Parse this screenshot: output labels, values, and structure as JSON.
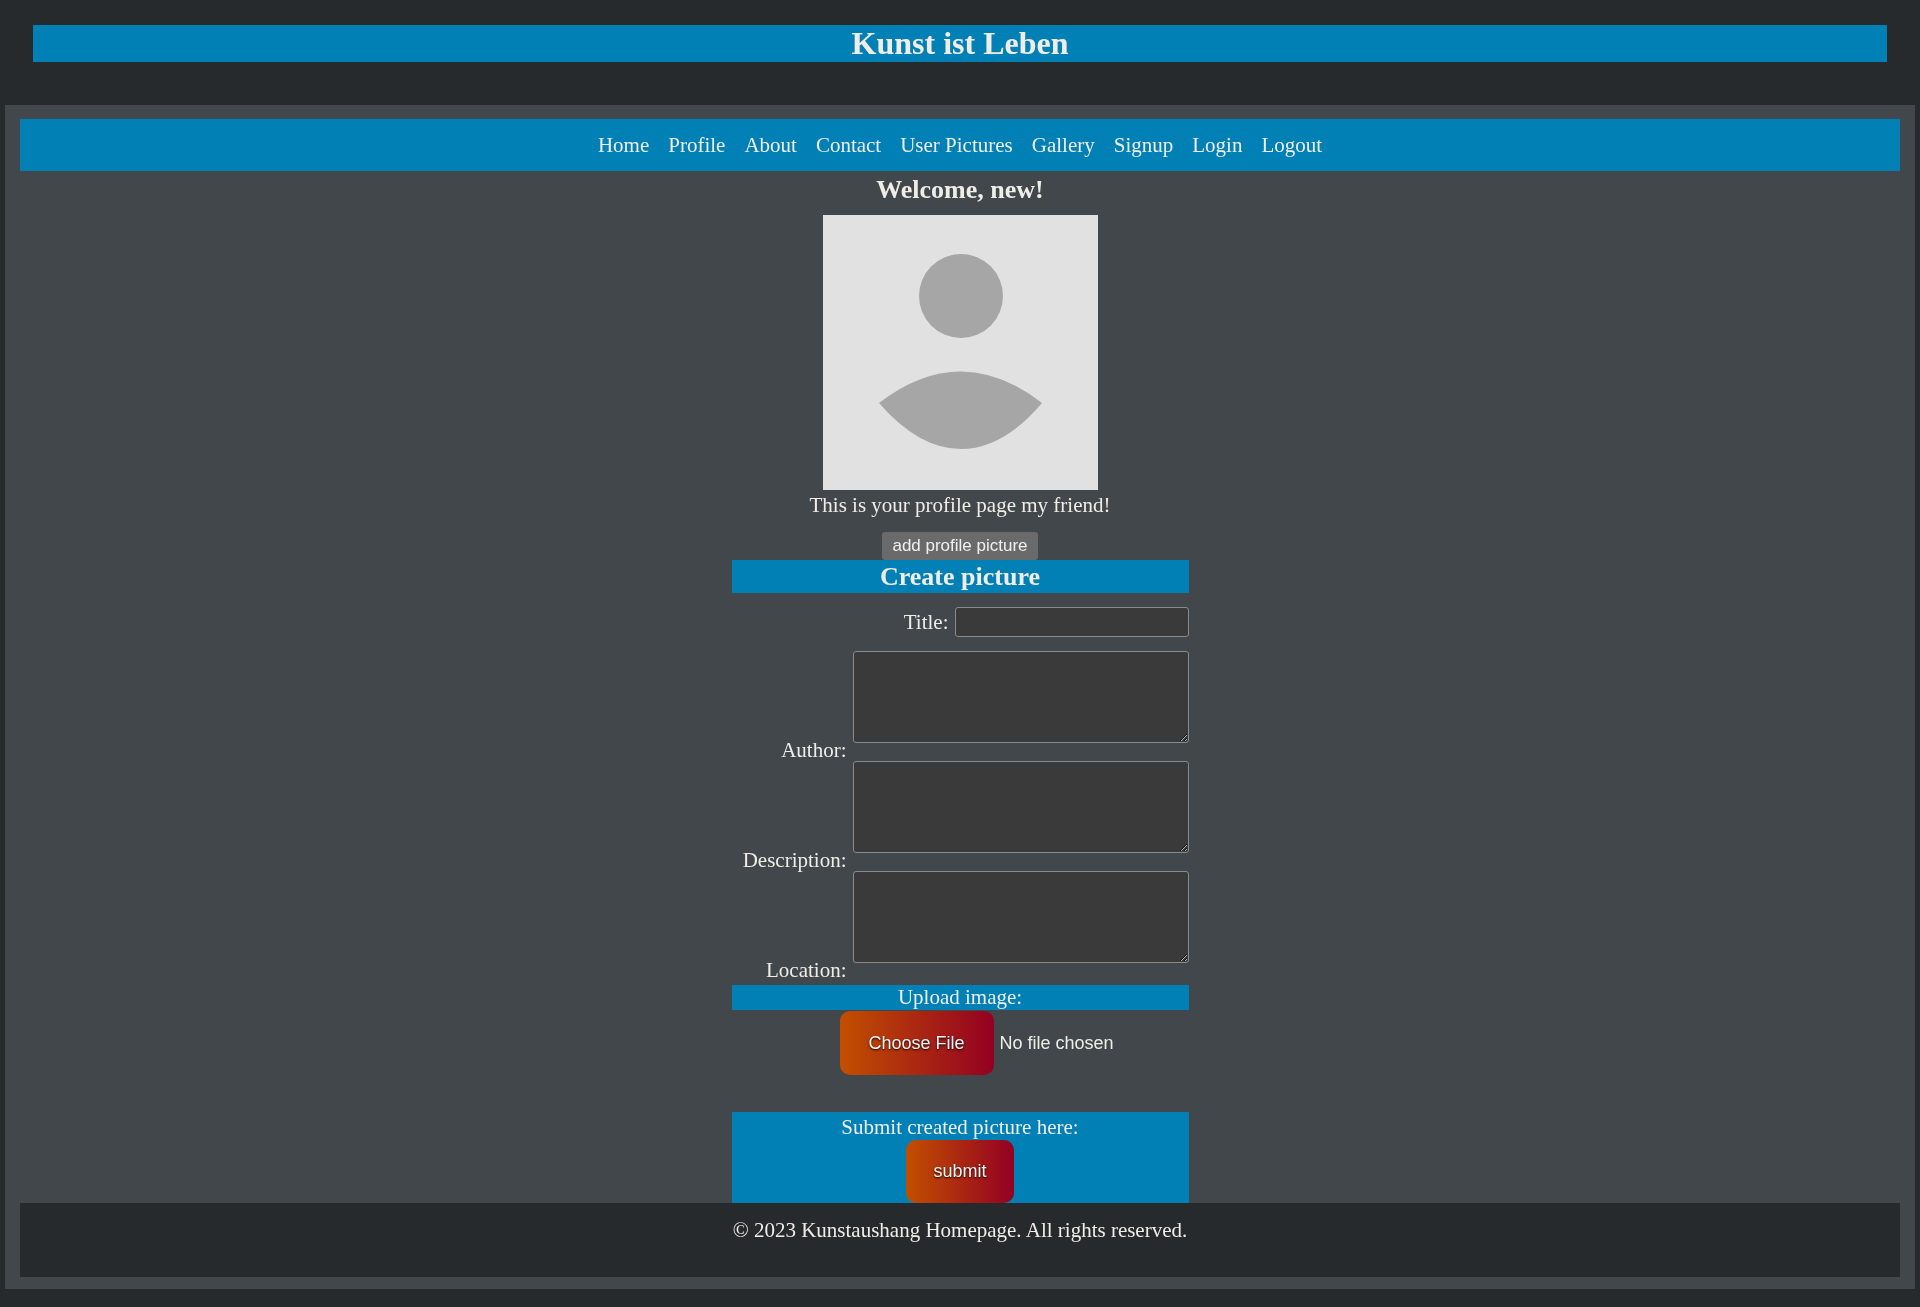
{
  "site_title": "Kunst ist Leben",
  "nav": [
    "Home",
    "Profile",
    "About",
    "Contact",
    "User Pictures",
    "Gallery",
    "Signup",
    "Login",
    "Logout"
  ],
  "welcome": "Welcome, new!",
  "profile_caption": "This is your profile page my friend!",
  "add_picture_button": "add profile picture",
  "form": {
    "title": "Create picture",
    "fields": [
      {
        "label": "Title:",
        "kind": "input"
      },
      {
        "label": "Author:",
        "kind": "textarea"
      },
      {
        "label": "Description:",
        "kind": "textarea"
      },
      {
        "label": "Location:",
        "kind": "textarea"
      }
    ],
    "upload": {
      "label": "Upload image:",
      "button": "Choose File",
      "status": "No file chosen"
    },
    "submit": {
      "label": "Submit created picture here:",
      "button": "submit"
    }
  },
  "footer": "© 2023 Kunstaushang Homepage. All rights reserved."
}
